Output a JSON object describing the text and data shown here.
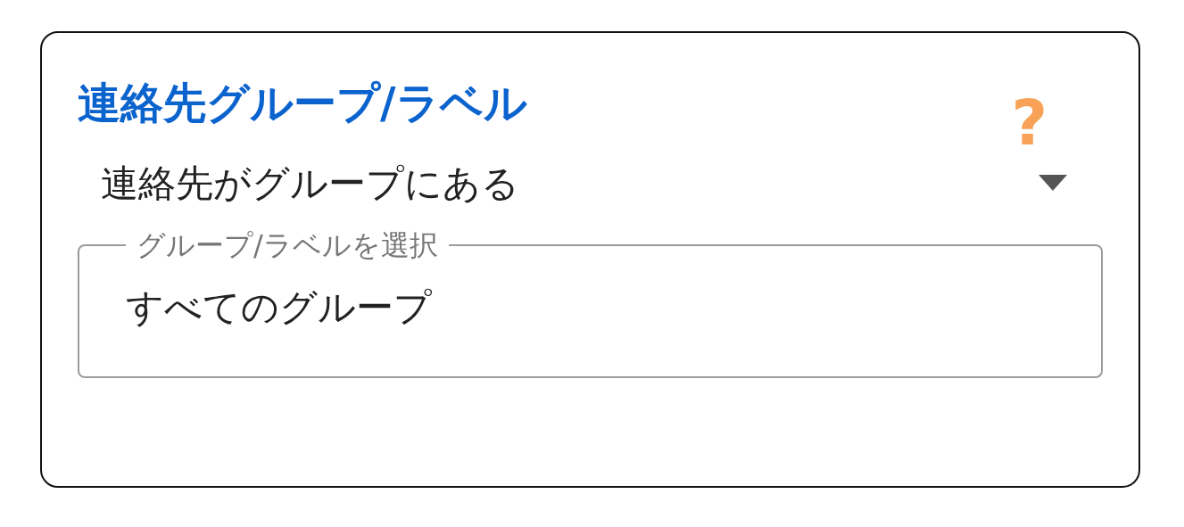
{
  "card": {
    "title": "連絡先グループ/ラベル",
    "help": "?"
  },
  "condition_dropdown": {
    "value": "連絡先がグループにある"
  },
  "group_field": {
    "label": "グループ/ラベルを選択",
    "value": "すべてのグループ"
  }
}
